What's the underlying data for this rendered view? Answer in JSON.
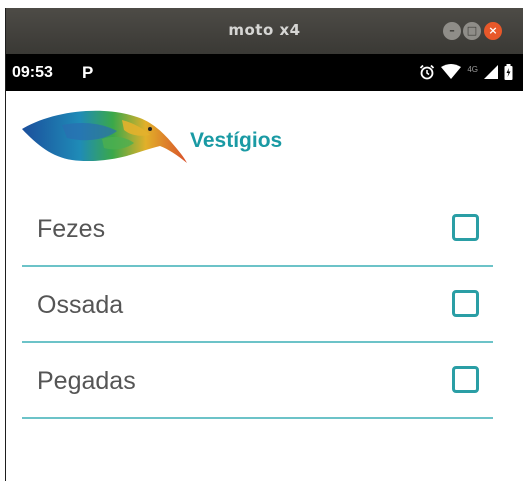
{
  "window": {
    "title": "moto x4",
    "min_glyph": "–",
    "max_glyph": "□",
    "close_glyph": "×"
  },
  "status_bar": {
    "time": "09:53",
    "notification": "P",
    "network": "4G",
    "icons": [
      "alarm-icon",
      "wifi-icon",
      "signal-icon",
      "battery-icon"
    ]
  },
  "app": {
    "title": "Vestígios",
    "accent": "#1a9aa4"
  },
  "items": [
    {
      "label": "Fezes",
      "checked": false
    },
    {
      "label": "Ossada",
      "checked": false
    },
    {
      "label": "Pegadas",
      "checked": false
    }
  ],
  "colors": {
    "divider": "#6cc3c8",
    "checkbox": "#2a9ea5",
    "close_button": "#e8582a"
  }
}
